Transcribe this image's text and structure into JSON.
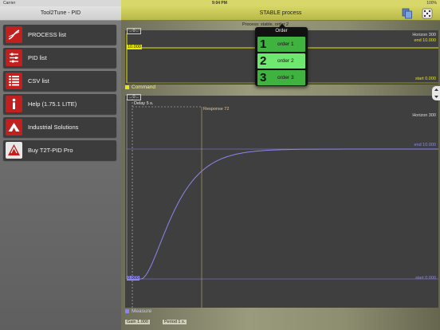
{
  "statusbar": {
    "carrier": "Carrier",
    "time": "9:04 PM",
    "battery": "100%"
  },
  "sidebar": {
    "title": "Tool2Tune - PID",
    "items": [
      {
        "label": "PROCESS list",
        "icon": "process-curve-icon"
      },
      {
        "label": "PID list",
        "icon": "sliders-icon"
      },
      {
        "label": "CSV list",
        "icon": "csv-table-icon"
      },
      {
        "label": "Help (1.75.1 LITE)",
        "icon": "info-icon"
      },
      {
        "label": "Industrial Solutions",
        "icon": "mountain-icon"
      },
      {
        "label": "Buy T2T-PID Pro",
        "icon": "pid-logo-icon"
      }
    ]
  },
  "header": {
    "title": "STABLE process",
    "icons": [
      "copy-icon",
      "dice-icon"
    ]
  },
  "process_label": "Process: stable, order 2",
  "command_chart": {
    "zoom_label": "→0←",
    "horizon": "Horizon 300",
    "end": "end 10.000",
    "start": "start 0.000",
    "value_label": "10.000",
    "legend": "Command",
    "color": "#e8e800"
  },
  "measure_chart": {
    "zoom_label": "→0←",
    "delay": "Delay 5 s.",
    "response": "Response 72",
    "horizon": "Horizon 300",
    "end": "end 10.000",
    "start": "start 0.000",
    "value_label": "0.000",
    "legend": "Measure",
    "color": "#8a86f0",
    "curve": {
      "delay": 5,
      "response": 72,
      "horizon": 300,
      "final": 10
    }
  },
  "footer": {
    "gain": "Gain 1.000",
    "period": "Period 1 s."
  },
  "order_popup": {
    "title": "Order",
    "items": [
      {
        "num": "1",
        "label": "order 1",
        "color": "#3fb23f"
      },
      {
        "num": "2",
        "label": "order 2",
        "color": "#6ee86e"
      },
      {
        "num": "3",
        "label": "order 3",
        "color": "#3fb23f"
      }
    ],
    "selected": 1
  }
}
